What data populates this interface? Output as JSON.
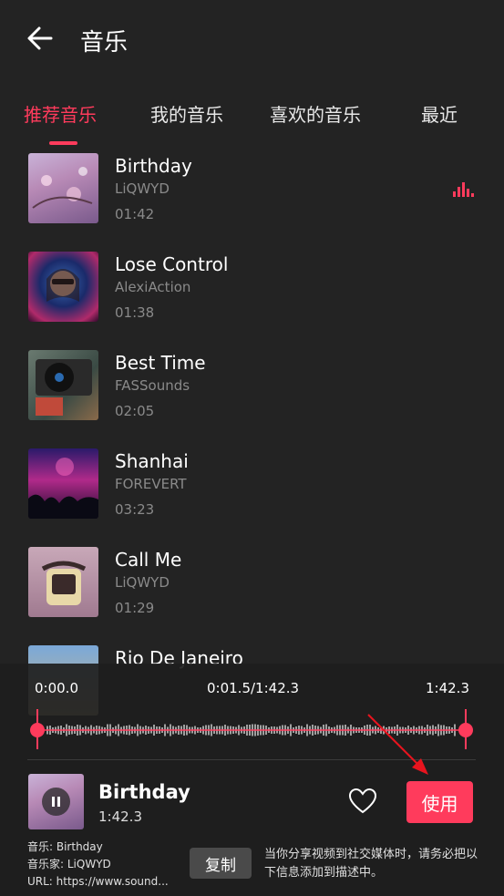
{
  "header": {
    "title": "音乐"
  },
  "tabs": [
    {
      "label": "推荐音乐",
      "active": true
    },
    {
      "label": "我的音乐",
      "active": false
    },
    {
      "label": "喜欢的音乐",
      "active": false
    },
    {
      "label": "最近",
      "active": false
    }
  ],
  "songs": [
    {
      "title": "Birthday",
      "artist": "LiQWYD",
      "duration": "01:42",
      "playing": true
    },
    {
      "title": "Lose Control",
      "artist": "AlexiAction",
      "duration": "01:38"
    },
    {
      "title": "Best Time",
      "artist": "FASSounds",
      "duration": "02:05"
    },
    {
      "title": "Shanhai",
      "artist": "FOREVERT",
      "duration": "03:23"
    },
    {
      "title": "Call Me",
      "artist": "LiQWYD",
      "duration": "01:29"
    },
    {
      "title": "Rio De Janeiro",
      "artist": "",
      "duration": ""
    }
  ],
  "player": {
    "time_start": "0:00.0",
    "time_current": "0:01.5/1:42.3",
    "time_end": "1:42.3",
    "track_title": "Birthday",
    "track_duration": "1:42.3",
    "use_label": "使用",
    "copy_label": "复制",
    "credit_music": "音乐: Birthday",
    "credit_artist": "音乐家: LiQWYD",
    "credit_url": "URL: https://www.sound...",
    "notice": "当你分享视频到社交媒体时，请务必把以下信息添加到描述中。"
  },
  "colors": {
    "accent": "#ff3b5c",
    "background": "#232323"
  },
  "icons": {
    "back": "back-arrow-icon",
    "heart": "heart-icon",
    "pause": "pause-icon",
    "playing": "playing-bars-icon"
  }
}
